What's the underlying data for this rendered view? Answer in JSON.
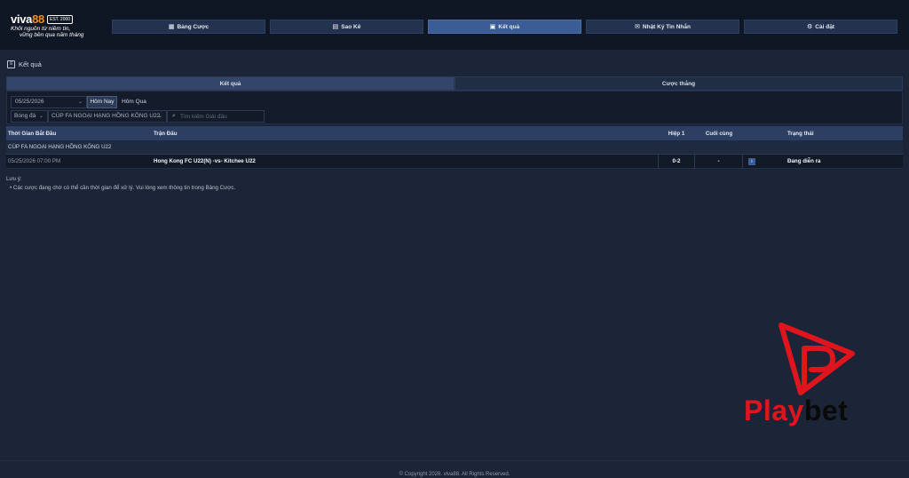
{
  "brand": {
    "name_main": "viva",
    "name_accent": "88",
    "est": "EST. 2000",
    "tagline_1": "Khởi nguồn từ niềm tin,",
    "tagline_2": "vững bền qua năm tháng"
  },
  "nav": [
    {
      "label": "Bảng Cược",
      "icon": "table-icon",
      "glyph": "▦",
      "active": false
    },
    {
      "label": "Sao Kê",
      "icon": "document-icon",
      "glyph": "▤",
      "active": false
    },
    {
      "label": "Kết quả",
      "icon": "results-icon",
      "glyph": "▣",
      "active": true
    },
    {
      "label": "Nhật Ký Tin Nhắn",
      "icon": "envelope-icon",
      "glyph": "✉",
      "active": false
    },
    {
      "label": "Cài đặt",
      "icon": "gear-icon",
      "glyph": "⚙",
      "active": false
    }
  ],
  "page_title": "Kết quả",
  "tabs": [
    {
      "label": "Kết quả",
      "active": true
    },
    {
      "label": "Cược thắng",
      "active": false
    }
  ],
  "filters": {
    "date": "05/25/2026",
    "today": "Hôm Nay",
    "yesterday": "Hôm Qua",
    "sport": "Bóng đá",
    "league": "CÚP FA NGOẠI HẠNG HỒNG KÔNG U22",
    "search_placeholder": "Tìm kiếm Giải đấu"
  },
  "table": {
    "headers": {
      "time": "Thời Gian Bắt Đầu",
      "match": "Trận Đấu",
      "h1": "Hiệp 1",
      "final": "Cuối cùng",
      "status": "Trạng thái"
    },
    "group": "CÚP FA NGOẠI HẠNG HỒNG KÔNG U22",
    "rows": [
      {
        "time": "05/25/2026 07:00 PM",
        "match": "Hong Kong FC U22(N) -vs- Kitchee U22",
        "h1": "0-2",
        "final": "-",
        "info": "i",
        "status": "Đang diễn ra"
      }
    ]
  },
  "note": {
    "title": "Lưu ý:",
    "items": [
      "Các cược đang chờ có thể cần thời gian để xử lý. Vui lòng xem thông tin trong Bảng Cược."
    ]
  },
  "watermark": {
    "part1": "Play",
    "part2": "bet"
  },
  "footer": "© Copyright 2026. viva88. All Rights Reserved.",
  "colors": {
    "accent": "#3b5c94",
    "brand_orange": "#f08c1d",
    "watermark_red": "#e0141c"
  }
}
